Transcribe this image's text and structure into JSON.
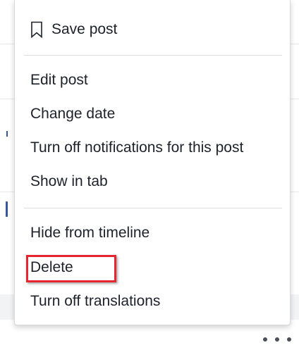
{
  "menu": {
    "save_post_label": "Save post",
    "section_two": {
      "edit_post_label": "Edit post",
      "change_date_label": "Change date",
      "turn_off_notifications_label": "Turn off notifications for this post",
      "show_in_tab_label": "Show in tab"
    },
    "section_three": {
      "hide_from_timeline_label": "Hide from timeline",
      "delete_label": "Delete",
      "turn_off_translations_label": "Turn off translations"
    }
  },
  "icons": {
    "save": "bookmark-icon",
    "more": "more-options-icon"
  },
  "colors": {
    "text": "#1d2129",
    "highlight_border": "#e8242f",
    "separator": "#dddfe2",
    "more_dots": "#4b4f56"
  }
}
